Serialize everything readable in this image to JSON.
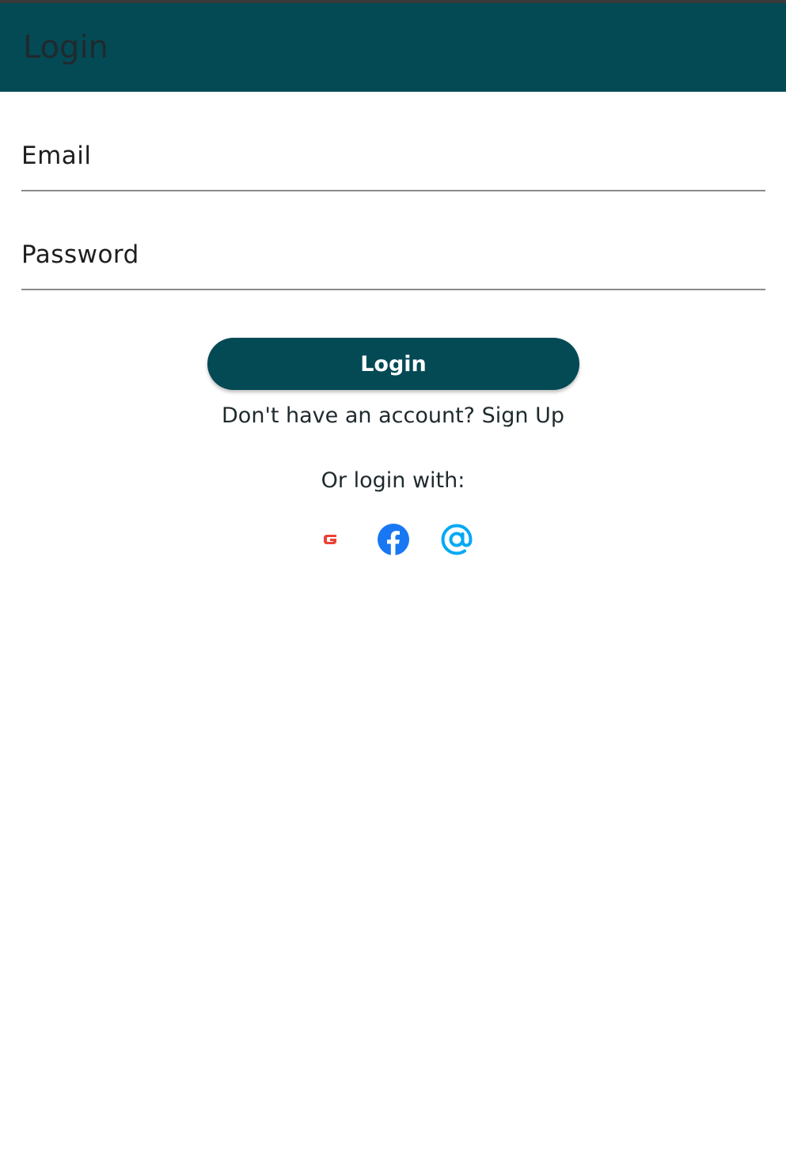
{
  "app_bar": {
    "title": "Login",
    "bg_color": "#044a55"
  },
  "form": {
    "email": {
      "placeholder": "Email",
      "value": ""
    },
    "password": {
      "placeholder": "Password",
      "value": ""
    }
  },
  "login_button": {
    "label": "Login"
  },
  "signup": {
    "prefix": "Don't have an account?",
    "link": "Sign Up"
  },
  "social": {
    "heading": "Or login with:",
    "providers": [
      {
        "name": "google-icon",
        "color": "#ea4335"
      },
      {
        "name": "facebook-icon",
        "color": "#1877f2"
      },
      {
        "name": "email-at-icon",
        "color": "#03a9f4"
      }
    ]
  }
}
